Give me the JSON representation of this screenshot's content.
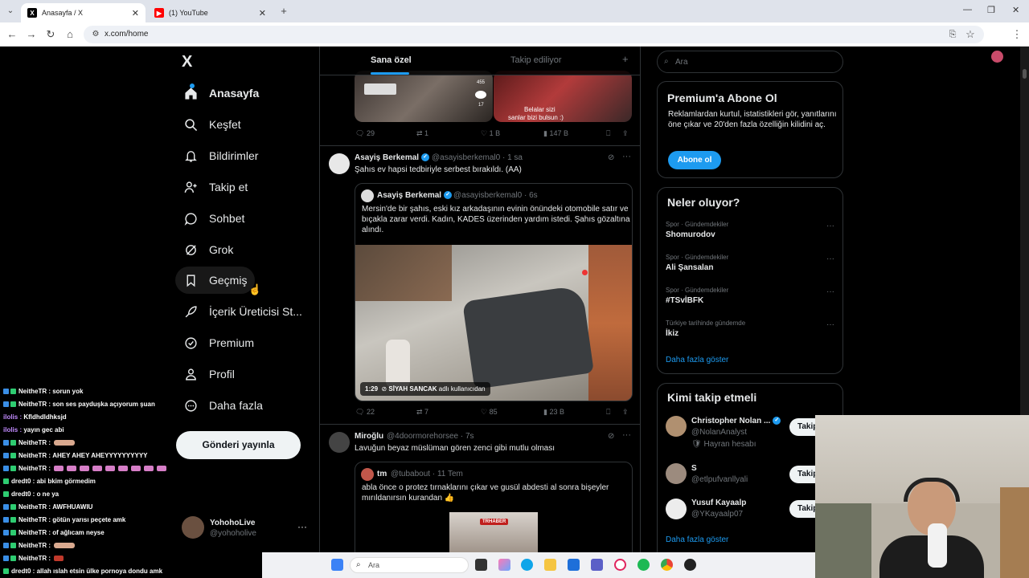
{
  "browser": {
    "tabs": [
      {
        "title": "Anasayfa / X",
        "active": true
      },
      {
        "title": "(1) YouTube",
        "active": false
      }
    ],
    "url": "x.com/home",
    "new_tab": "+",
    "window_min": "—",
    "window_max": "❐",
    "window_close": "✕"
  },
  "nav": {
    "logo": "X",
    "items": [
      {
        "label": "Anasayfa",
        "icon": "home-icon",
        "bold": true
      },
      {
        "label": "Keşfet",
        "icon": "search-icon"
      },
      {
        "label": "Bildirimler",
        "icon": "bell-icon"
      },
      {
        "label": "Takip et",
        "icon": "follow-icon"
      },
      {
        "label": "Sohbet",
        "icon": "chat-icon"
      },
      {
        "label": "Grok",
        "icon": "grok-icon"
      },
      {
        "label": "Geçmiş",
        "icon": "bookmark-icon"
      },
      {
        "label": "İçerik Üreticisi St...",
        "icon": "creator-icon"
      },
      {
        "label": "Premium",
        "icon": "premium-icon"
      },
      {
        "label": "Profil",
        "icon": "profile-icon"
      },
      {
        "label": "Daha fazla",
        "icon": "more-icon"
      }
    ],
    "post_button": "Gönderi yayınla",
    "account": {
      "name": "YohohoLive",
      "handle": "@yohoholive",
      "more": "···"
    }
  },
  "feed": {
    "tabs": [
      "Sana özel",
      "Takip ediliyor"
    ],
    "add_icon": "+",
    "first_tweet": {
      "overlay_text_1": "Belalar sizi",
      "overlay_text_2": "sanlar bizi bulsun :)",
      "side_count_1": "455",
      "side_count_2": "17",
      "actions": {
        "replies": "29",
        "reposts": "1",
        "likes": "1 B",
        "views": "147 B"
      }
    },
    "tweet2": {
      "name": "Asayiş Berkemal",
      "handle": "@asayisberkemal0",
      "time": "· 1 sa",
      "text": "Şahıs ev hapsi tedbiriyle serbest bırakıldı. (AA)",
      "quote": {
        "name": "Asayiş Berkemal",
        "handle": "@asayisberkemal0 · 6s",
        "text": "Mersin'de bir şahıs, eski kız arkadaşının evinin önündeki otomobile satır ve bıçakla zarar verdi. Kadın, KADES üzerinden yardım istedi. Şahıs gözaltına alındı.",
        "video_time": "1:29",
        "video_source": "SİYAH SANCAK",
        "video_source_suffix": "adlı kullanıcıdan"
      },
      "actions": {
        "replies": "22",
        "reposts": "7",
        "likes": "85",
        "views": "23 B"
      }
    },
    "tweet3": {
      "name": "Miroğlu",
      "handle": "@4doormorehorsee · 7s",
      "text": "Lavuğun beyaz müslüman gören zenci gibi mutlu olması",
      "quote": {
        "name": "tm",
        "handle": "@tubabout · 11 Tem",
        "text": "abla önce o protez tırnaklarını çıkar ve gusül abdesti al sonra bişeyler mırıldanırsın kurandan 👍",
        "media_logo": "TRHABER"
      }
    }
  },
  "sidebar": {
    "search_placeholder": "Ara",
    "premium": {
      "title": "Premium'a Abone Ol",
      "text": "Reklamlardan kurtul, istatistikleri gör, yanıtlarını öne çıkar ve 20'den fazla özelliğin kilidini aç.",
      "button": "Abone ol"
    },
    "trends": {
      "title": "Neler oluyor?",
      "items": [
        {
          "category": "Spor · Gündemdekiler",
          "name": "Shomurodov"
        },
        {
          "category": "Spor · Gündemdekiler",
          "name": "Ali Şansalan"
        },
        {
          "category": "Spor · Gündemdekiler",
          "name": "#TSvİBFK"
        },
        {
          "category": "Türkiye tarihinde gündemde",
          "name": "İkiz"
        }
      ],
      "more_icon": "···",
      "show_more": "Daha fazla göster"
    },
    "who_to_follow": {
      "title": "Kimi takip etmeli",
      "items": [
        {
          "name": "Christopher Nolan ...",
          "handle": "@NolanAnalyst",
          "extra": "Hayran hesabı",
          "button": "Takip"
        },
        {
          "name": "S",
          "handle": "@etlpufvanllyali",
          "button": "Takip"
        },
        {
          "name": "Yusuf Kayaalp",
          "handle": "@YKayaalp07",
          "button": "Takip"
        }
      ],
      "show_more": "Daha fazla göster"
    }
  },
  "chat": [
    {
      "user": "NeitheTR",
      "msg": "sorun yok",
      "type": "badge"
    },
    {
      "user": "NeitheTR",
      "msg": "son ses payduşka açıyorum şuan",
      "type": "badge"
    },
    {
      "user": "ilolis",
      "msg": "Kfldhdldhksjd",
      "type": "plain"
    },
    {
      "user": "ilolis",
      "msg": "yayın gec abi",
      "type": "plain"
    },
    {
      "user": "NeitheTR",
      "msg": "",
      "type": "badge",
      "emote": "skin"
    },
    {
      "user": "NeitheTR",
      "msg": "AHEY AHEY AHEYYYYYYYYYY",
      "type": "badge"
    },
    {
      "user": "NeitheTR",
      "msg": "",
      "type": "badge",
      "emote": "pink"
    },
    {
      "user": "dredt0",
      "msg": "abi bkim görmedim",
      "type": "green"
    },
    {
      "user": "dredt0",
      "msg": "o ne ya",
      "type": "green"
    },
    {
      "user": "NeitheTR",
      "msg": "AWFHUAWIU",
      "type": "badge"
    },
    {
      "user": "NeitheTR",
      "msg": "götün yarısı peçete amk",
      "type": "badge"
    },
    {
      "user": "NeitheTR",
      "msg": "of ağlıcam neyse",
      "type": "badge"
    },
    {
      "user": "NeitheTR",
      "msg": "",
      "type": "badge",
      "emote": "skin"
    },
    {
      "user": "NeitheTR",
      "msg": "",
      "type": "badge",
      "emote": "red"
    },
    {
      "user": "dredt0",
      "msg": "allah ıslah etsin ülke pornoya dondu amk",
      "type": "green"
    }
  ],
  "taskbar": {
    "search": "Ara"
  },
  "colors": {
    "accent": "#1d9bf0",
    "background": "#000000",
    "border": "#2f3336",
    "muted": "#71767b"
  }
}
